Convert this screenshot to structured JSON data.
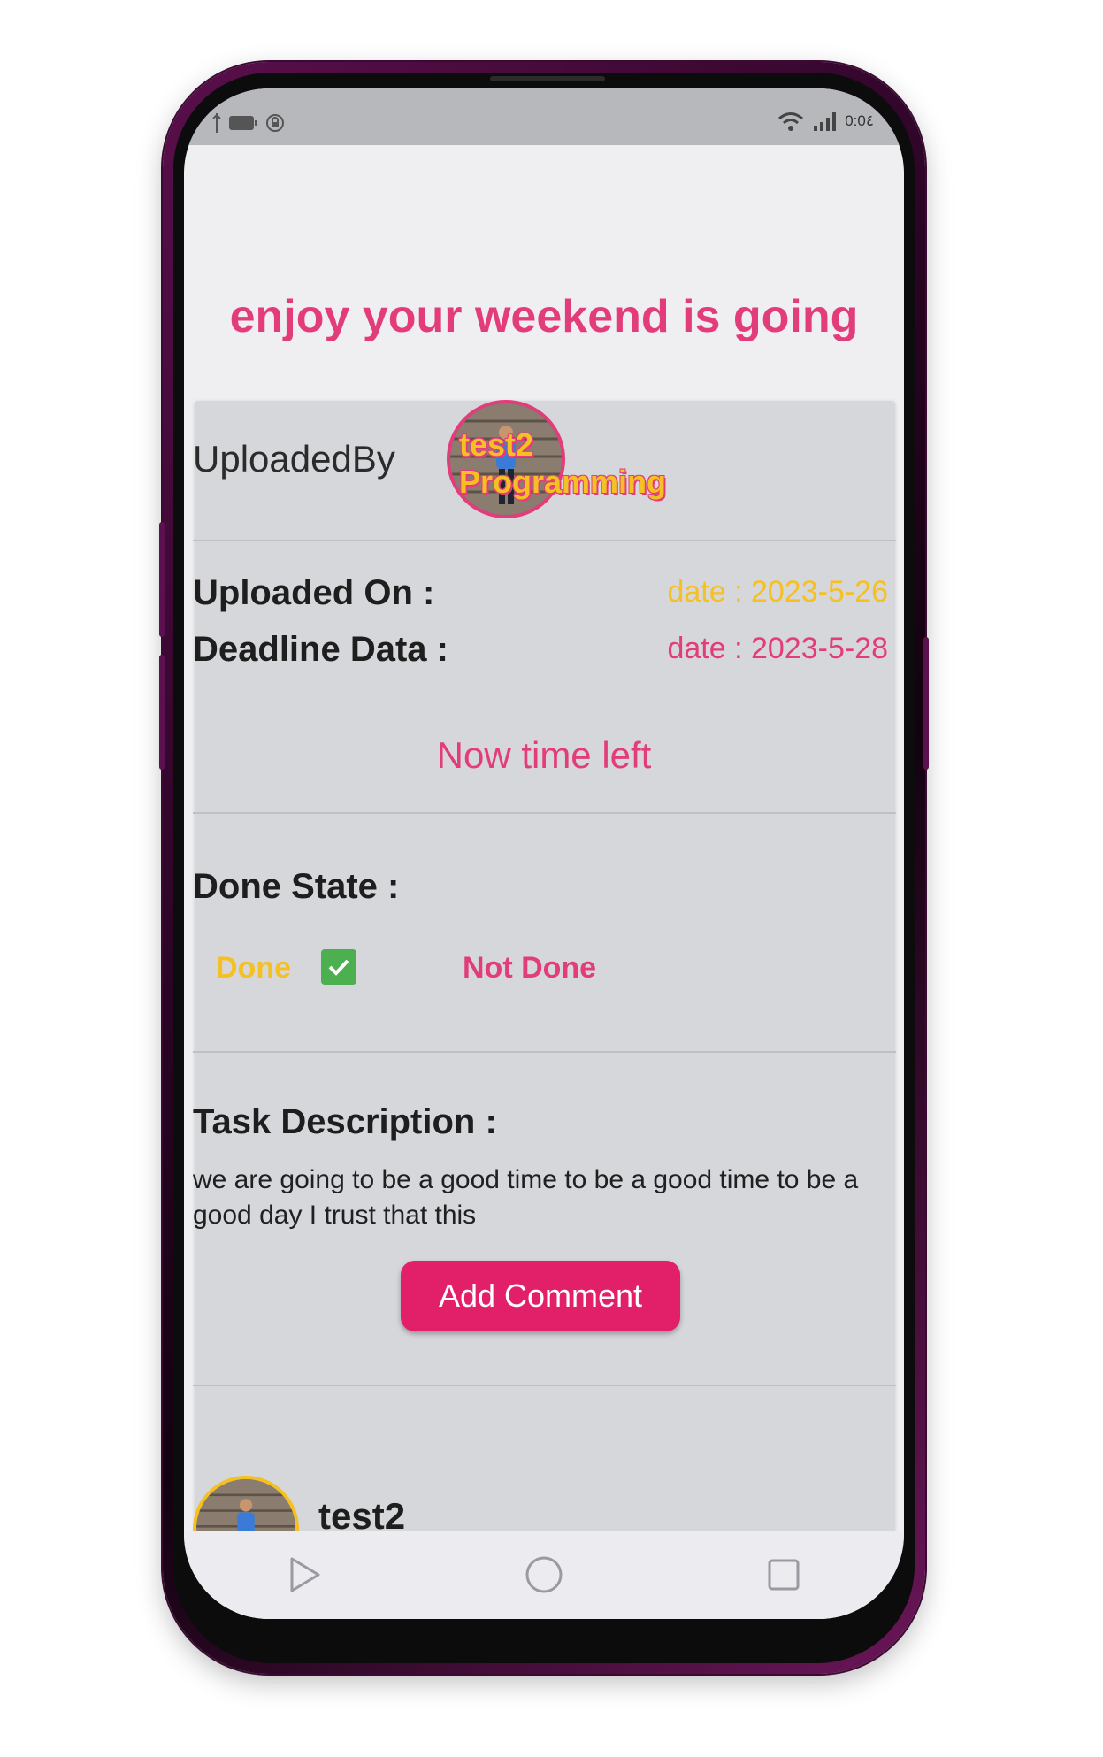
{
  "status_bar": {
    "time": "0:0٤",
    "left_icons": [
      "usb-icon",
      "battery-icon",
      "lock-icon"
    ],
    "right_icons": [
      "wifi-icon",
      "signal-icon"
    ]
  },
  "task": {
    "title": "enjoy your weekend is going",
    "uploaded_by_label": "UploadedBy",
    "uploader_name": "test2",
    "uploader_position": "Programming",
    "uploaded_on_label": "Uploaded On :",
    "uploaded_on_value": "date : 2023-5-26",
    "deadline_label": "Deadline Data :",
    "deadline_value": "date : 2023-5-28",
    "time_left": "Now time left",
    "done_state_label": "Done State :",
    "done_label": "Done",
    "not_done_label": "Not Done",
    "done_checked": true,
    "description_label": "Task Description :",
    "description_text": "we are going to be a good time to be a good time to be a good day I trust that this",
    "add_comment_label": "Add Comment"
  },
  "comments": [
    {
      "name": "test2"
    }
  ],
  "nav": [
    "back-icon",
    "home-icon",
    "recents-icon"
  ],
  "colors": {
    "accent_pink": "#e23d7a",
    "accent_yellow": "#f5c022",
    "button_pink": "#e2206a",
    "check_green": "#4caf50",
    "card_bg": "#d6d7db"
  }
}
